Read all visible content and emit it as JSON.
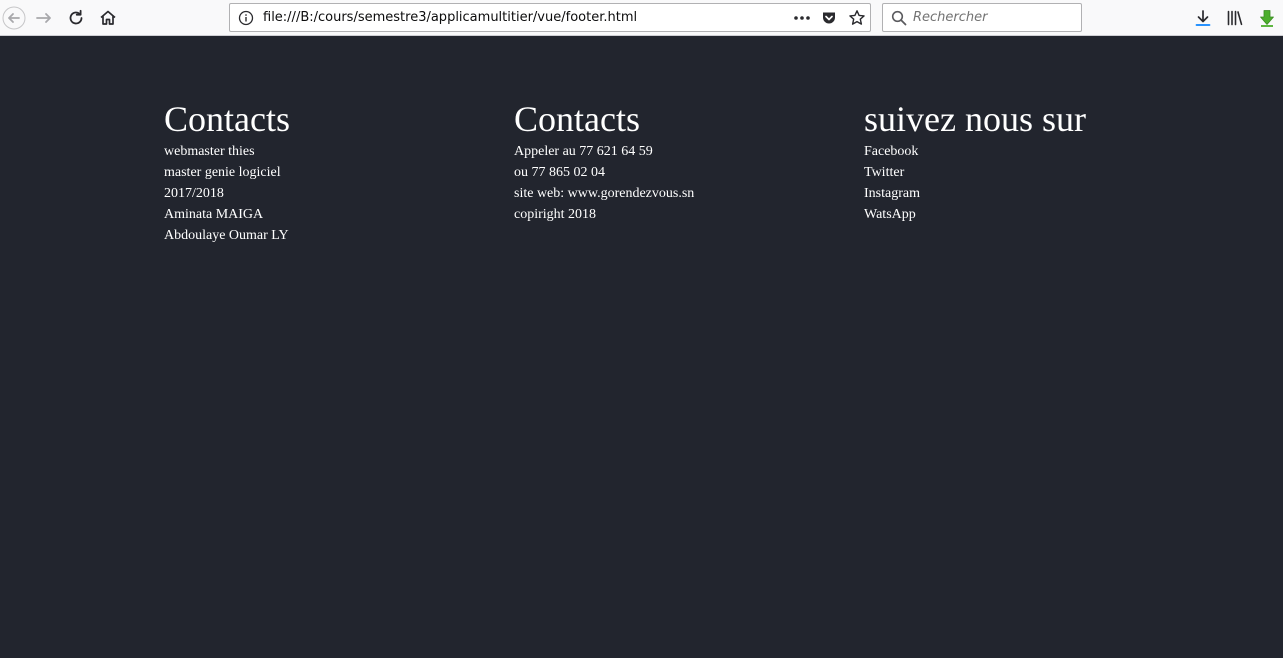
{
  "browser": {
    "url": "file:///B:/cours/semestre3/applicamultitier/vue/footer.html",
    "search_placeholder": "Rechercher"
  },
  "footer": {
    "columns": [
      {
        "title": "Contacts",
        "items": [
          "webmaster thies",
          "master genie logiciel",
          "2017/2018",
          "Aminata MAIGA",
          "Abdoulaye Oumar LY"
        ]
      },
      {
        "title": "Contacts",
        "items": [
          "Appeler au 77 621 64 59",
          "ou 77 865 02 04",
          "site web: www.gorendezvous.sn",
          "copiright 2018"
        ]
      },
      {
        "title": "suivez nous sur",
        "items": [
          "Facebook",
          "Twitter",
          "Instagram",
          "WatsApp"
        ]
      }
    ]
  },
  "colors": {
    "footer_background": "#22252e",
    "footer_text": "#ffffff",
    "toolbar_background": "#f9f9fa",
    "download_arrow": "#4cae2c"
  }
}
